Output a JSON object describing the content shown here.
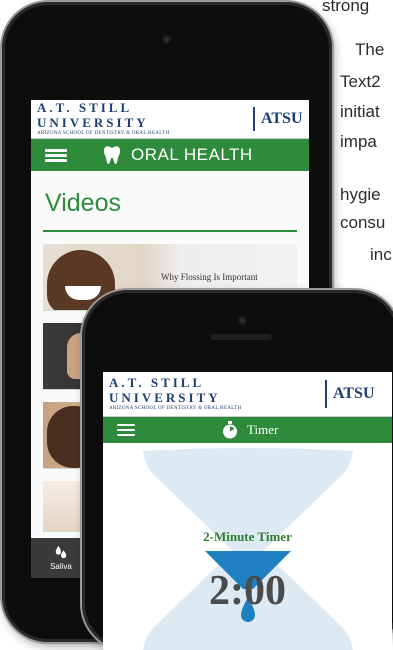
{
  "article": {
    "lines": [
      "strong",
      "The",
      "Text2",
      "initiat",
      "impa",
      "hygie",
      "consu",
      "inc"
    ]
  },
  "phone_videos": {
    "header": {
      "university": "A.T. STILL UNIVERSITY",
      "school": "ARIZONA SCHOOL OF DENTISTRY & ORAL HEALTH",
      "abbr": "ATSU"
    },
    "nav": {
      "title": "ORAL HEALTH",
      "menu_icon": "hamburger-icon",
      "logo_icon": "tooth-icon"
    },
    "section_title": "Videos",
    "videos": [
      {
        "caption": "Why Flossing Is Important"
      }
    ],
    "tabbar": {
      "label": "Saliva",
      "icon": "drops-icon"
    }
  },
  "phone_timer": {
    "header": {
      "university": "A.T. STILL UNIVERSITY",
      "school": "ARIZONA SCHOOL OF DENTISTRY & ORAL HEALTH",
      "abbr": "ATSU"
    },
    "nav": {
      "title": "Timer",
      "menu_icon": "hamburger-icon",
      "timer_icon": "stopwatch-icon"
    },
    "timer": {
      "label": "2-Minute Timer",
      "value": "2:00"
    }
  },
  "colors": {
    "green": "#2e8b3c",
    "navy": "#1d3f73",
    "hourglass": "#dbe8f3",
    "sand": "#1f7fc0"
  }
}
